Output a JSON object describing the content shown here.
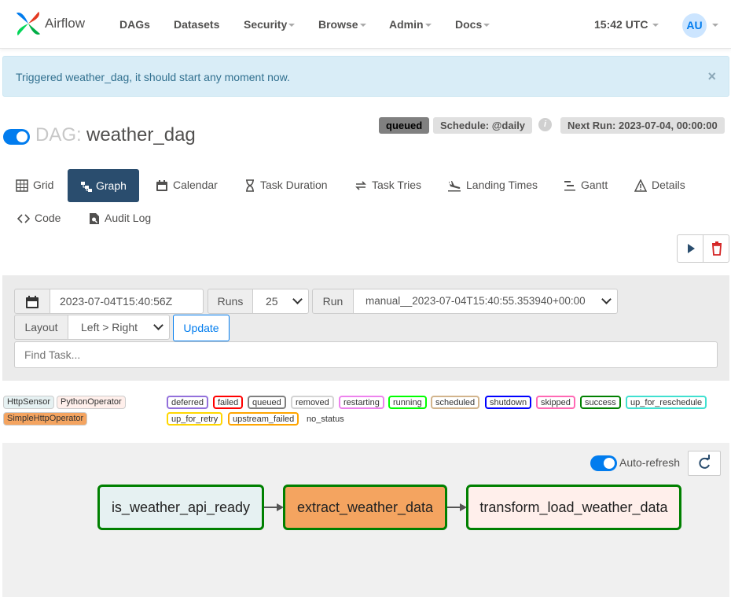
{
  "nav": {
    "brand": "Airflow",
    "items": [
      "DAGs",
      "Datasets",
      "Security",
      "Browse",
      "Admin",
      "Docs"
    ],
    "time": "15:42 UTC",
    "user_initials": "AU"
  },
  "alert": {
    "message": "Triggered weather_dag, it should start any moment now.",
    "close": "×"
  },
  "dag": {
    "prefix": "DAG:",
    "name": "weather_dag",
    "state": "queued",
    "schedule": "Schedule: @daily",
    "next_run": "Next Run: 2023-07-04, 00:00:00"
  },
  "tabs": [
    "Grid",
    "Graph",
    "Calendar",
    "Task Duration",
    "Task Tries",
    "Landing Times",
    "Gantt",
    "Details",
    "Code",
    "Audit Log"
  ],
  "active_tab": "Graph",
  "filters": {
    "base_date": "2023-07-04T15:40:56Z",
    "runs_label": "Runs",
    "runs_value": "25",
    "run_label": "Run",
    "run_value": "manual__2023-07-04T15:40:55.353940+00:00",
    "layout_label": "Layout",
    "layout_value": "Left > Right",
    "update_label": "Update",
    "find_placeholder": "Find Task..."
  },
  "operators": [
    {
      "name": "HttpSensor",
      "bg": "#e6f1f2"
    },
    {
      "name": "PythonOperator",
      "bg": "#ffefeb"
    },
    {
      "name": "SimpleHttpOperator",
      "bg": "#f4a460"
    }
  ],
  "states": [
    {
      "name": "deferred",
      "color": "#9370db"
    },
    {
      "name": "failed",
      "color": "#ff0000"
    },
    {
      "name": "queued",
      "color": "#808080"
    },
    {
      "name": "removed",
      "color": "#d3d3d3"
    },
    {
      "name": "restarting",
      "color": "#ee82ee"
    },
    {
      "name": "running",
      "color": "#00ff00"
    },
    {
      "name": "scheduled",
      "color": "#d2b48c"
    },
    {
      "name": "shutdown",
      "color": "#0000ff"
    },
    {
      "name": "skipped",
      "color": "#ff69b4"
    },
    {
      "name": "success",
      "color": "#008000"
    },
    {
      "name": "up_for_reschedule",
      "color": "#40e0d0"
    },
    {
      "name": "up_for_retry",
      "color": "#ffd700"
    },
    {
      "name": "upstream_failed",
      "color": "#ffa500"
    },
    {
      "name": "no_status",
      "color": ""
    }
  ],
  "graph": {
    "auto_refresh_label": "Auto-refresh",
    "nodes": [
      {
        "id": "is_weather_api_ready",
        "operator": "HttpSensor",
        "fill": "#e6f1f2",
        "state": "success"
      },
      {
        "id": "extract_weather_data",
        "operator": "SimpleHttpOperator",
        "fill": "#f4a460",
        "state": "success"
      },
      {
        "id": "transform_load_weather_data",
        "operator": "PythonOperator",
        "fill": "#ffefeb",
        "state": "success"
      }
    ]
  },
  "colors": {
    "accent": "#017cee",
    "active_tab": "#2a4d6e",
    "success_border": "#008000"
  }
}
